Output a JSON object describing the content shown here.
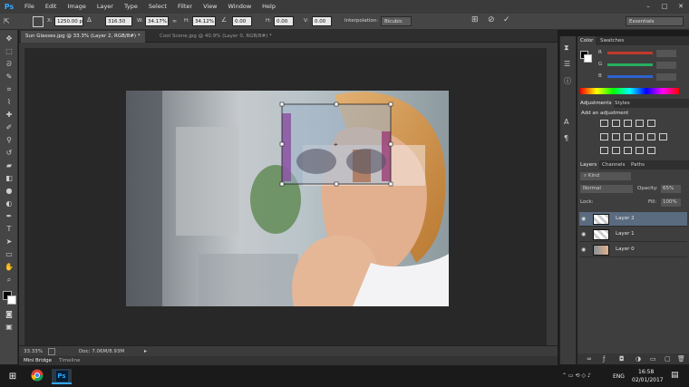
{
  "menubar": {
    "logo": "Ps",
    "items": [
      "File",
      "Edit",
      "Image",
      "Layer",
      "Type",
      "Select",
      "Filter",
      "View",
      "Window",
      "Help"
    ]
  },
  "options": {
    "x_label": "X:",
    "x_value": "1250.00 p",
    "y_value": "316.50 px",
    "w_label": "W:",
    "w_value": "34.17%",
    "h_label": "H:",
    "h_value": "34.12%",
    "angle_value": "0.00",
    "hskew_label": "H:",
    "hskew_value": "0.00",
    "vskew_label": "V:",
    "vskew_value": "0.00",
    "interp_label": "Interpolation:",
    "interp_value": "Bicubic",
    "workspace": "Essentials"
  },
  "tabs": [
    {
      "label": "Sun Glasses.jpg @ 33.3% (Layer 2, RGB/8#) *",
      "active": true
    },
    {
      "label": "Cool Scene.jpg @ 40.9% (Layer 0, RGB/8#) *",
      "active": false
    }
  ],
  "status": {
    "zoom": "33.33%",
    "doc": "Doc: 7.06M/8.93M"
  },
  "bottom_tabs": [
    "Mini Bridge",
    "Timeline"
  ],
  "color_panel": {
    "tabs": [
      "Color",
      "Swatches"
    ],
    "channels": [
      {
        "label": "R",
        "color": "#c0392b"
      },
      {
        "label": "G",
        "color": "#27ae60"
      },
      {
        "label": "B",
        "color": "#2e62d0"
      }
    ]
  },
  "adjustments_panel": {
    "tabs": [
      "Adjustments",
      "Styles"
    ],
    "title": "Add an adjustment"
  },
  "layers_panel": {
    "tabs": [
      "Layers",
      "Channels",
      "Paths"
    ],
    "kind": "Kind",
    "blend_mode": "Normal",
    "opacity_label": "Opacity:",
    "opacity_value": "65%",
    "lock_label": "Lock:",
    "fill_label": "Fill:",
    "fill_value": "100%",
    "layers": [
      {
        "name": "Layer 2",
        "selected": true
      },
      {
        "name": "Layer 1",
        "selected": false
      },
      {
        "name": "Layer 0",
        "selected": false
      }
    ]
  },
  "taskbar": {
    "lang": "ENG",
    "time": "16:58",
    "date": "02/01/2017"
  },
  "icons": {
    "ps_logo_color": "#31a8ff",
    "accent": "#31a8ff"
  }
}
